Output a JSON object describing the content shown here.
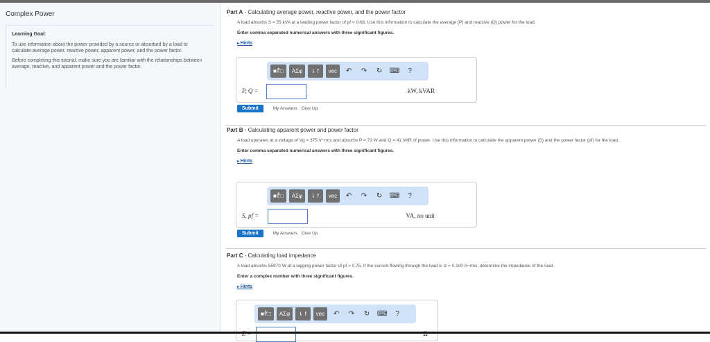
{
  "left": {
    "title": "Complex Power",
    "goal_heading": "Learning Goal:",
    "goal_p1": "To use information about the power provided by a source or absorbed by a load to calculate average power, reactive power, apparent power, and the power factor.",
    "goal_p2": "Before completing this tutorial, make sure you are familiar with the relationships between average, reactive, and apparent power and the power factor."
  },
  "toolbar": {
    "templates": "■∜□",
    "greek": "ΑΣφ",
    "arrows": "⇂↾",
    "vec": "vec",
    "undo": "↶",
    "redo": "↷",
    "reset": "↻",
    "keyboard": "⌨",
    "help": "?"
  },
  "common": {
    "hints": "Hints",
    "submit": "Submit",
    "my_answers": "My Answers",
    "give_up": "Give Up"
  },
  "parts": [
    {
      "label": "Part A",
      "title": " - Calculating average power, reactive power, and the power factor",
      "text": "A load absorbs S = 55 kVA at a leading power factor of pf = 0.68. Use this information to calculate the average (P) and reactive (Q) power for the load.",
      "instruction": "Enter comma separated numerical answers with three significant figures.",
      "answer_label": "P, Q =",
      "answer_value": "",
      "unit": "kW, kVAR"
    },
    {
      "label": "Part B",
      "title": " - Calculating apparent power and power factor",
      "text": "A load operates at a voltage of Vg = 375 V−rms and absorbs P = 73 W and Q = 41 VAR of power. Use this information to calculate the apparent power (S) and the power factor (pf) for the load.",
      "instruction": "Enter comma separated numerical answers with three significant figures.",
      "answer_label": "S, pf =",
      "answer_value": "",
      "unit": "VA, no unit"
    },
    {
      "label": "Part C",
      "title": " - Calculating load impedance",
      "text": "A load absorbs 55970 W at a lagging power factor of pf = 0.75. If the current flowing through the load is iz = 0.100 A−rms, determine the impedance of the load.",
      "instruction": "Enter a complex number with three significant figures.",
      "answer_label": "Z =",
      "answer_value": "",
      "unit": "Ω"
    }
  ]
}
